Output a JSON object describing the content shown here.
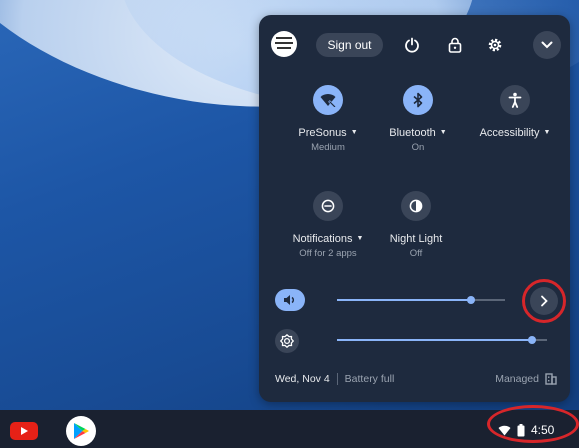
{
  "account": {
    "avatar_icon": "account-avatar",
    "sign_out_label": "Sign out"
  },
  "top_buttons": [
    "power-icon",
    "lock-icon",
    "settings-gear-icon",
    "chevron-down-icon"
  ],
  "tiles": [
    {
      "label": "PreSonus",
      "sub": "Medium",
      "icon": "wifi-icon",
      "on": true,
      "has_menu": true
    },
    {
      "label": "Bluetooth",
      "sub": "On",
      "icon": "bluetooth-icon",
      "on": true,
      "has_menu": true
    },
    {
      "label": "Accessibility",
      "sub": "",
      "icon": "accessibility-icon",
      "on": false,
      "has_menu": true
    },
    {
      "label": "Notifications",
      "sub": "Off for 2 apps",
      "icon": "do-not-disturb-icon",
      "on": false,
      "has_menu": true
    },
    {
      "label": "Night Light",
      "sub": "Off",
      "icon": "night-light-icon",
      "on": false,
      "has_menu": false
    }
  ],
  "sliders": {
    "volume": {
      "icon": "volume-icon",
      "level": 0.8
    },
    "brightness": {
      "icon": "brightness-icon",
      "level": 0.93
    }
  },
  "footer": {
    "date": "Wed, Nov 4",
    "battery": "Battery full",
    "managed": "Managed"
  },
  "shelf": {
    "apps": [
      "youtube-app-icon",
      "play-store-app-icon"
    ],
    "time": "4:50"
  },
  "colors": {
    "accent": "#8ab4f8",
    "panel": "#1e2a3e",
    "highlight_circle": "#d7262a"
  }
}
